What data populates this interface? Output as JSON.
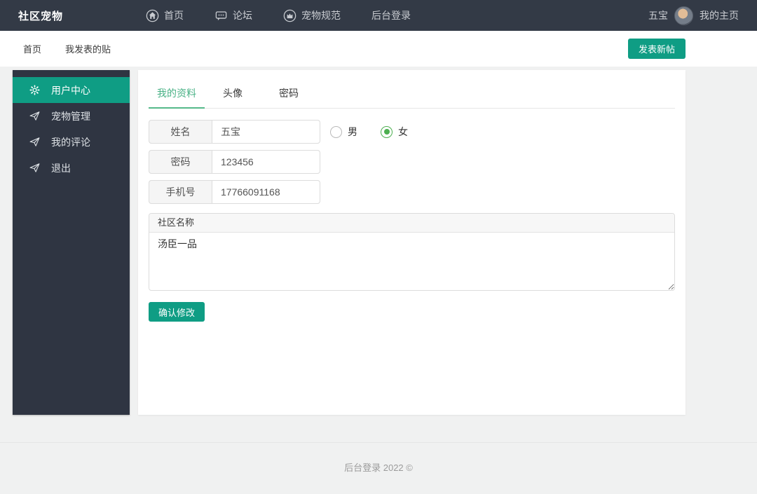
{
  "navbar": {
    "brand": "社区宠物",
    "items": [
      {
        "label": "首页",
        "icon": "home-icon"
      },
      {
        "label": "论坛",
        "icon": "comment-icon"
      },
      {
        "label": "宠物规范",
        "icon": "crown-icon"
      },
      {
        "label": "后台登录",
        "icon": "none"
      }
    ],
    "username": "五宝",
    "profile_link": "我的主页"
  },
  "subheader": {
    "links": [
      {
        "label": "首页"
      },
      {
        "label": "我发表的贴"
      }
    ],
    "new_post_button": "发表新帖"
  },
  "sidebar": {
    "items": [
      {
        "label": "用户中心",
        "icon": "gear-icon",
        "active": true
      },
      {
        "label": "宠物管理",
        "icon": "send-icon",
        "active": false
      },
      {
        "label": "我的评论",
        "icon": "send-icon",
        "active": false
      },
      {
        "label": "退出",
        "icon": "send-icon",
        "active": false
      }
    ]
  },
  "main": {
    "tabs": [
      {
        "label": "我的资料",
        "active": true
      },
      {
        "label": "头像",
        "active": false
      },
      {
        "label": "密码",
        "active": false
      }
    ],
    "form": {
      "name_label": "姓名",
      "name_value": "五宝",
      "gender_male_label": "男",
      "gender_female_label": "女",
      "gender_selected": "女",
      "password_label": "密码",
      "password_value": "123456",
      "phone_label": "手机号",
      "phone_value": "17766091168",
      "community_label": "社区名称",
      "community_value": "汤臣一品",
      "submit_button": "确认修改"
    }
  },
  "footer": {
    "text": "后台登录  2022 ©"
  },
  "colors": {
    "accent_teal": "#0f9d84",
    "tab_active_green": "#48b185",
    "radio_green": "#4caf50",
    "navbar_bg": "#333a46",
    "sidebar_bg": "#2f3542",
    "page_bg": "#f0f1f1"
  }
}
